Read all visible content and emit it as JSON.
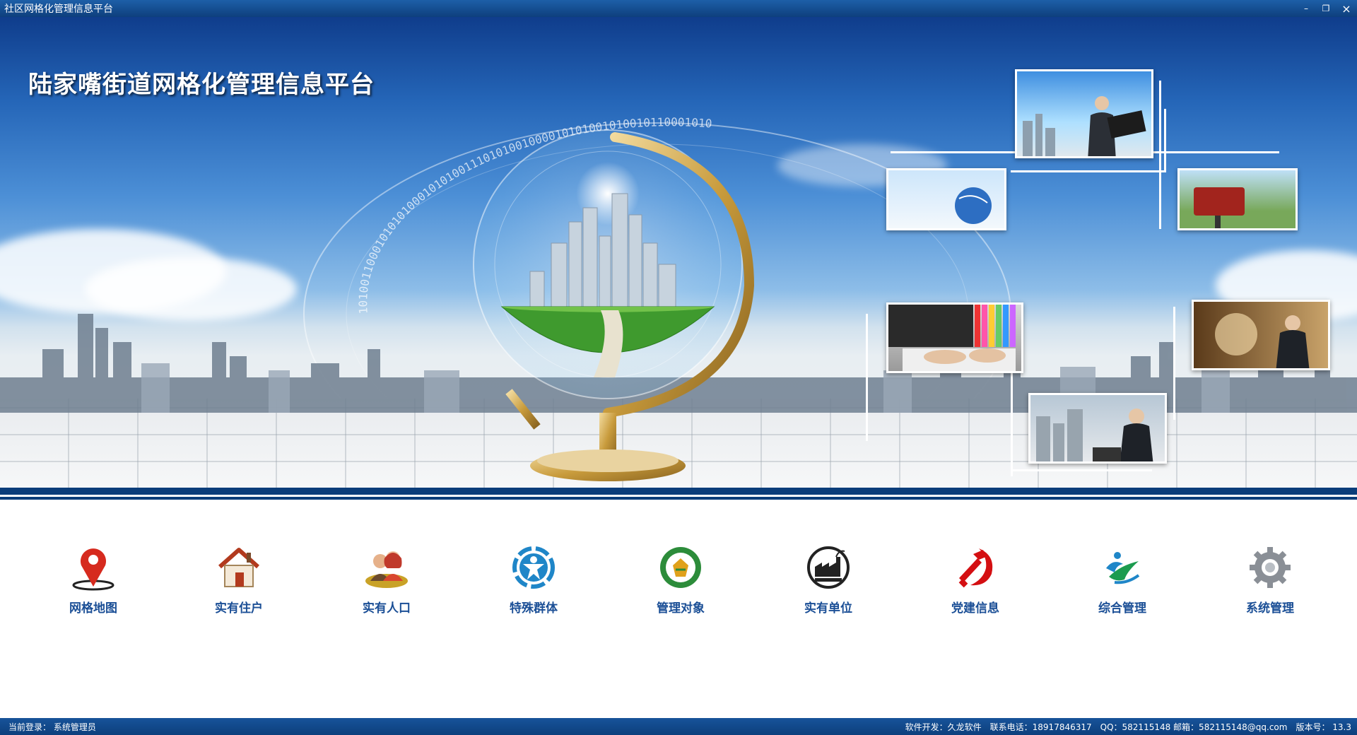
{
  "window": {
    "title": "社区网格化管理信息平台",
    "controls": {
      "minimize": "–",
      "restore": "❐",
      "close": "×"
    }
  },
  "banner": {
    "title": "陆家嘴街道网格化管理信息平台",
    "binary_text": "1010011000101010100010101001110101001000010101001010010110001010"
  },
  "menu": [
    {
      "label": "网格地图",
      "icon": "map-pin-icon",
      "color": "#d62a1e"
    },
    {
      "label": "实有住户",
      "icon": "house-icon",
      "color": "#b23a1e"
    },
    {
      "label": "实有人口",
      "icon": "people-icon",
      "color": "#c9a227"
    },
    {
      "label": "特殊群体",
      "icon": "special-group-icon",
      "color": "#1f86c8"
    },
    {
      "label": "管理对象",
      "icon": "management-badge-icon",
      "color": "#2c8c3a"
    },
    {
      "label": "实有单位",
      "icon": "industry-icon",
      "color": "#222222"
    },
    {
      "label": "党建信息",
      "icon": "party-emblem-icon",
      "color": "#d40f12"
    },
    {
      "label": "综合管理",
      "icon": "integrated-logo-icon",
      "color": "#1c9b4f"
    },
    {
      "label": "系统管理",
      "icon": "gear-icon",
      "color": "#8a8f96"
    }
  ],
  "status": {
    "login": "当前登录： 系统管理员",
    "developer": "软件开发：久龙软件",
    "phone": "联系电话：18917846317",
    "qq_email": "QQ：582115148 邮箱：582115148@qq.com",
    "version": "版本号：  13.3"
  }
}
